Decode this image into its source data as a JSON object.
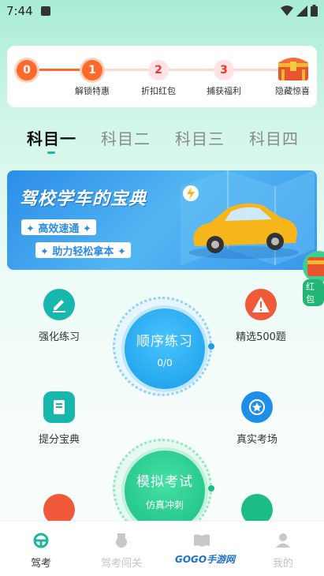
{
  "status_bar": {
    "time": "7:44"
  },
  "progress": {
    "steps": [
      {
        "number": "0",
        "label": ""
      },
      {
        "number": "1",
        "label": "解锁特惠"
      },
      {
        "number": "2",
        "label": "折扣红包"
      },
      {
        "number": "3",
        "label": "捕获福利"
      }
    ],
    "final_label": "隐藏惊喜",
    "active_count": 2
  },
  "tabs": [
    {
      "label": "科目一",
      "active": true
    },
    {
      "label": "科目二",
      "active": false
    },
    {
      "label": "科目三",
      "active": false
    },
    {
      "label": "科目四",
      "active": false
    }
  ],
  "banner": {
    "title": "驾校学车的宝典",
    "pill1": "✦ 高效速通 ✦",
    "pill2": "✦ 助力轻松拿本 ✦"
  },
  "red_packet": {
    "label": "红包"
  },
  "features": {
    "strengthen": "强化练习",
    "selected": "精选500题",
    "score": "提分宝典",
    "real_exam": "真实考场"
  },
  "sequence_practice": {
    "title": "顺序练习",
    "progress": "0/0"
  },
  "mock_exam": {
    "title": "模拟考试",
    "subtitle": "仿真冲刺"
  },
  "bottom_nav": [
    {
      "label": "驾考",
      "active": true
    },
    {
      "label": "驾考闯关",
      "active": false
    },
    {
      "label": "",
      "active": false
    },
    {
      "label": "我的",
      "active": false
    }
  ],
  "watermark": "GOGO手游网",
  "colors": {
    "accent": "#1db6a0",
    "orange": "#ff6a2b",
    "blue": "#2c8de8"
  }
}
